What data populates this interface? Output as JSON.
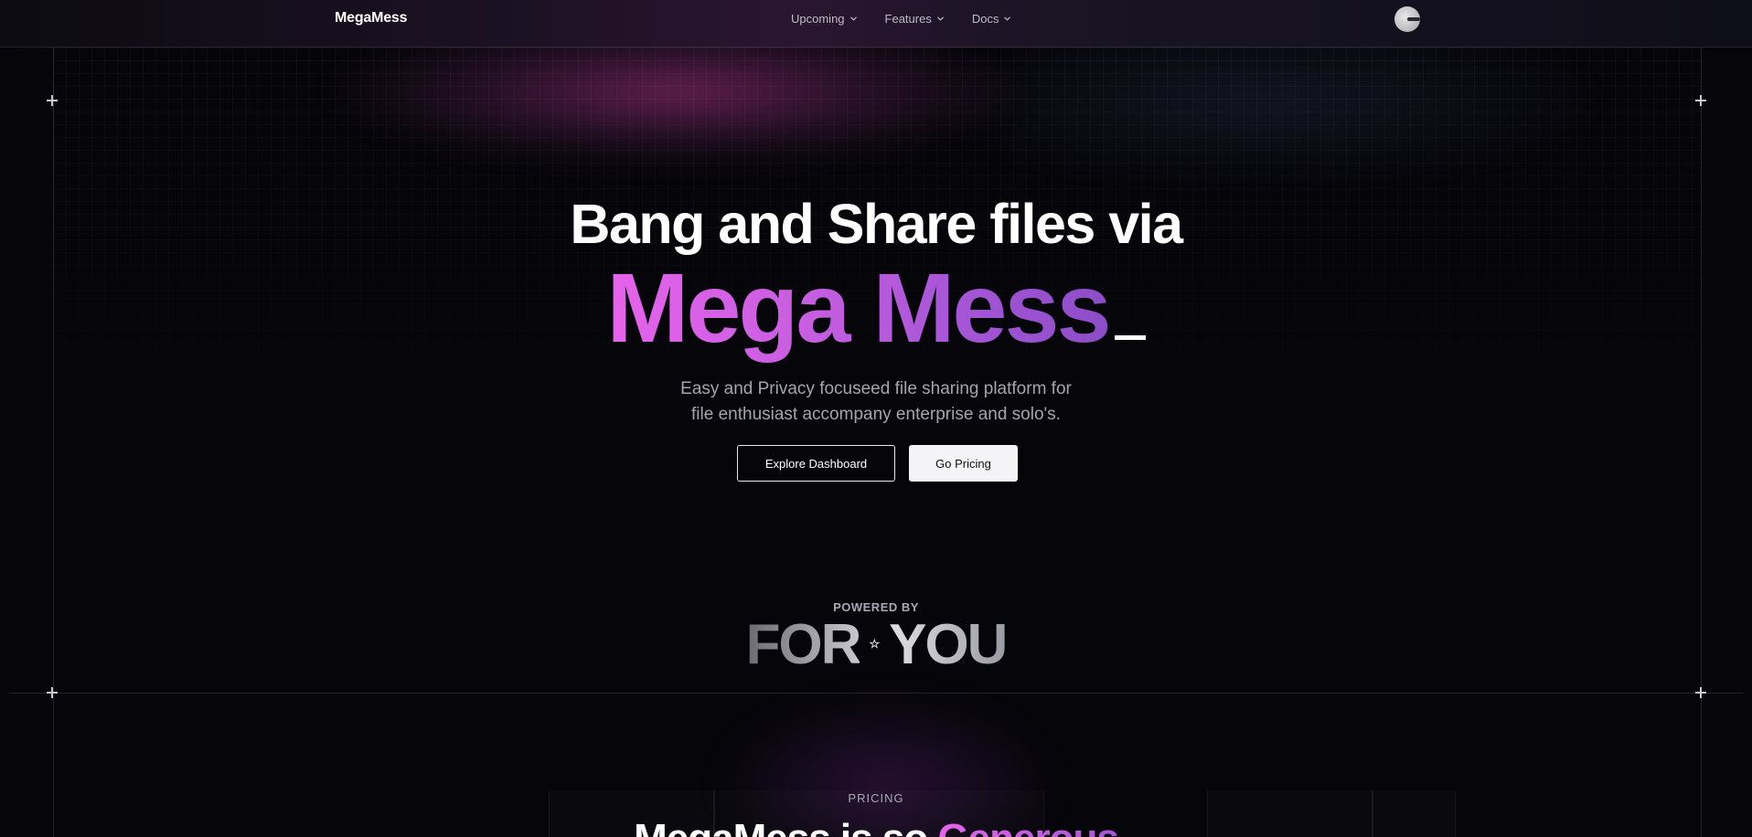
{
  "nav": {
    "brand": "MegaMess",
    "items": [
      {
        "label": "Upcoming",
        "icon": "chevron-down-icon"
      },
      {
        "label": "Features",
        "icon": "chevron-down-icon"
      },
      {
        "label": "Docs",
        "icon": "chevron-down-icon"
      }
    ],
    "avatar": "user-avatar"
  },
  "hero": {
    "line1": "Bang and Share files via",
    "line2": "Mega Mess",
    "subtitle_line1": "Easy and Privacy focuseed file sharing platform for",
    "subtitle_line2": "file enthusiast accompany enterprise and solo's.",
    "primary_button": "Explore Dashboard",
    "secondary_button": "Go Pricing"
  },
  "powered": {
    "label": "POWERED BY",
    "left_word": "FOR",
    "right_word": "YOU",
    "separator": "star-icon"
  },
  "pricing": {
    "label": "PRICING",
    "heading_main": "MegaMess is so ",
    "heading_accent": "Generous"
  },
  "colors": {
    "background": "#06060a",
    "accent_pink": "#e763ec",
    "accent_purple": "#8d4dc8",
    "button_solid": "#f4f4f6"
  }
}
